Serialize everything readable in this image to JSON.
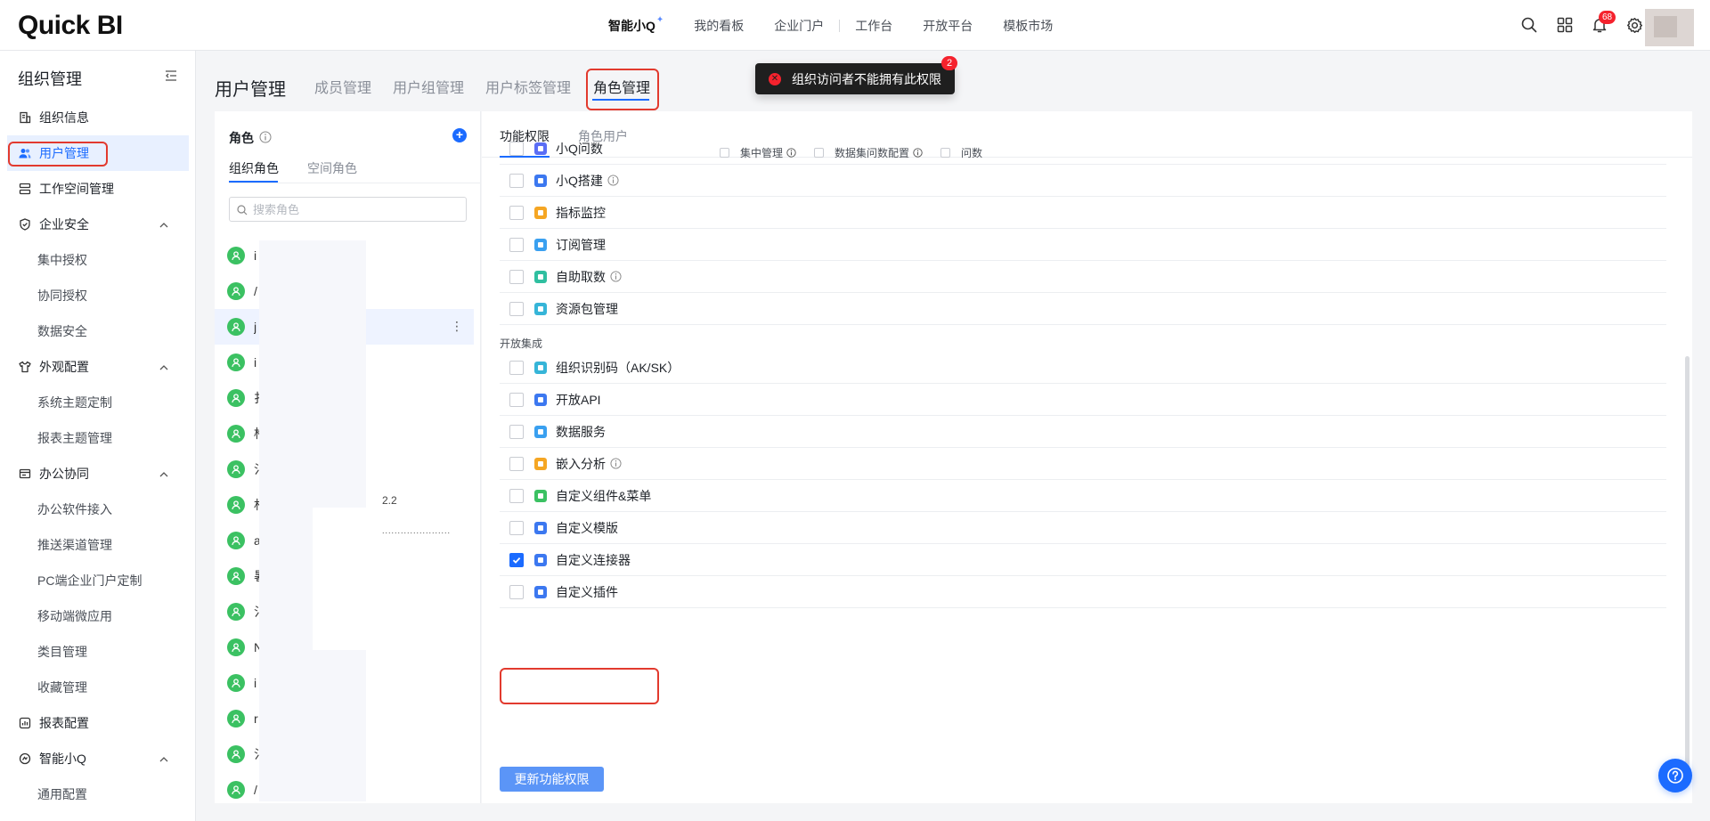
{
  "header": {
    "logo": "Quick BI",
    "nav": [
      {
        "label": "智能小Q"
      },
      {
        "label": "我的看板"
      },
      {
        "label": "企业门户"
      },
      {
        "label": "工作台"
      },
      {
        "label": "开放平台"
      },
      {
        "label": "模板市场"
      }
    ],
    "notification_count": "68",
    "icons": [
      "search-icon",
      "apps-grid-icon",
      "bell-icon",
      "gear-icon"
    ]
  },
  "sidebar": {
    "title": "组织管理",
    "items": [
      {
        "label": "组织信息",
        "icon": "org-info-icon"
      },
      {
        "label": "用户管理",
        "icon": "users-icon"
      },
      {
        "label": "工作空间管理",
        "icon": "workspace-icon"
      },
      {
        "label": "企业安全",
        "icon": "shield-icon"
      },
      {
        "label": "集中授权"
      },
      {
        "label": "协同授权"
      },
      {
        "label": "数据安全"
      },
      {
        "label": "外观配置",
        "icon": "shirt-icon"
      },
      {
        "label": "系统主题定制"
      },
      {
        "label": "报表主题管理"
      },
      {
        "label": "办公协同",
        "icon": "office-icon"
      },
      {
        "label": "办公软件接入"
      },
      {
        "label": "推送渠道管理"
      },
      {
        "label": "PC端企业门户定制"
      },
      {
        "label": "移动端微应用"
      },
      {
        "label": "类目管理"
      },
      {
        "label": "收藏管理"
      },
      {
        "label": "报表配置",
        "icon": "report-icon"
      },
      {
        "label": "智能小Q",
        "icon": "ai-icon"
      },
      {
        "label": "通用配置"
      }
    ]
  },
  "page": {
    "title": "用户管理",
    "tabs": [
      "成员管理",
      "用户组管理",
      "用户标签管理",
      "角色管理"
    ],
    "active_tab": "角色管理"
  },
  "toast": {
    "message": "组织访问者不能拥有此权限",
    "count": "2"
  },
  "role_panel": {
    "title": "角色",
    "tabs": [
      "组织角色",
      "空间角色"
    ],
    "search_placeholder": "搜索角色",
    "roles": [
      {
        "initial": "i",
        "note": ""
      },
      {
        "initial": "/",
        "note": ""
      },
      {
        "initial": "j",
        "note": ""
      },
      {
        "initial": "i",
        "note": ""
      },
      {
        "initial": "扌",
        "note": ""
      },
      {
        "initial": "柞",
        "note": ""
      },
      {
        "initial": "氵",
        "note": ""
      },
      {
        "initial": "杉",
        "note": "2.2"
      },
      {
        "initial": "a",
        "note": "......................"
      },
      {
        "initial": "暑",
        "note": ""
      },
      {
        "initial": "氵",
        "note": ""
      },
      {
        "initial": "N",
        "note": ""
      },
      {
        "initial": "i",
        "note": ""
      },
      {
        "initial": "r",
        "note": ""
      },
      {
        "initial": "氵",
        "note": ""
      },
      {
        "initial": "/",
        "note": ""
      }
    ],
    "more_icon": "⋮"
  },
  "perm_panel": {
    "tabs": [
      "功能权限",
      "角色用户"
    ],
    "rows_top": [
      {
        "label": "小Q问数",
        "color": "#5b6ef5",
        "checked": false,
        "info": false,
        "sub": [
          {
            "label": "集中管理",
            "info": true
          },
          {
            "label": "数据集问数配置",
            "info": true
          },
          {
            "label": "问数",
            "info": false
          }
        ]
      },
      {
        "label": "小Q搭建",
        "color": "#3c78f0",
        "checked": false,
        "info": true
      },
      {
        "label": "指标监控",
        "color": "#f5a623",
        "checked": false,
        "info": false
      },
      {
        "label": "订阅管理",
        "color": "#3aa0f0",
        "checked": false,
        "info": false
      },
      {
        "label": "自助取数",
        "color": "#2fbfa0",
        "checked": false,
        "info": true
      },
      {
        "label": "资源包管理",
        "color": "#36b5d8",
        "checked": false,
        "info": false
      }
    ],
    "section_label": "开放集成",
    "rows_bottom": [
      {
        "label": "组织识别码（AK/SK）",
        "color": "#36b5d8",
        "checked": false,
        "info": false
      },
      {
        "label": "开放API",
        "color": "#3c78f0",
        "checked": false,
        "info": false
      },
      {
        "label": "数据服务",
        "color": "#3aa0f0",
        "checked": false,
        "info": false
      },
      {
        "label": "嵌入分析",
        "color": "#f5a623",
        "checked": false,
        "info": true
      },
      {
        "label": "自定义组件&菜单",
        "color": "#3bc162",
        "checked": false,
        "info": false
      },
      {
        "label": "自定义模版",
        "color": "#3c78f0",
        "checked": false,
        "info": false
      },
      {
        "label": "自定义连接器",
        "color": "#3c78f0",
        "checked": true,
        "info": false
      },
      {
        "label": "自定义插件",
        "color": "#3c78f0",
        "checked": false,
        "info": false
      }
    ],
    "update_button": "更新功能权限"
  },
  "help_icon": "question-icon"
}
